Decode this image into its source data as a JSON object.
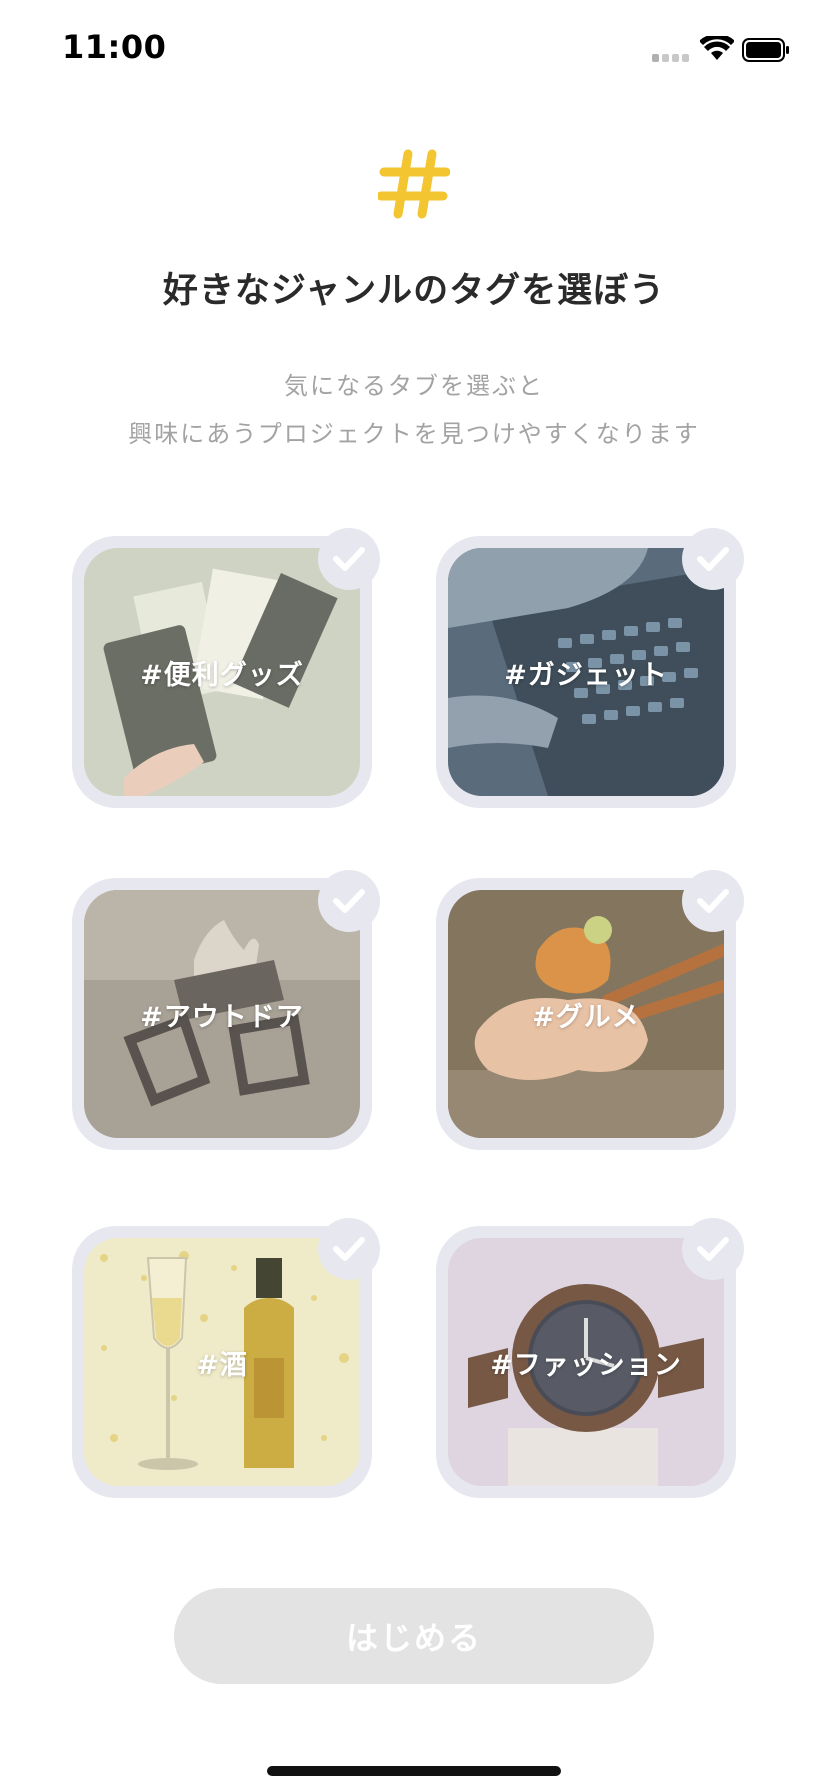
{
  "status_bar": {
    "time": "11:00",
    "icons": [
      "cellular-signal-icon",
      "wifi-icon",
      "battery-icon"
    ]
  },
  "header": {
    "icon": "hash-icon",
    "title": "好きなジャンルのタグを選ぼう",
    "subtitle_line1": "気になるタブを選ぶと",
    "subtitle_line2": "興味にあうプロジェクトを見つけやすくなります"
  },
  "tags": [
    {
      "label": "#便利グッズ",
      "selected": false,
      "icon": "check-icon"
    },
    {
      "label": "#ガジェット",
      "selected": false,
      "icon": "check-icon"
    },
    {
      "label": "#アウトドア",
      "selected": false,
      "icon": "check-icon"
    },
    {
      "label": "#グルメ",
      "selected": false,
      "icon": "check-icon"
    },
    {
      "label": "#酒",
      "selected": false,
      "icon": "check-icon"
    },
    {
      "label": "#ファッション",
      "selected": false,
      "icon": "check-icon"
    }
  ],
  "start_button": {
    "label": "はじめる",
    "enabled": false
  },
  "colors": {
    "accent_yellow": "#f2c531",
    "card_border": "#e6e7ef",
    "button_disabled": "#e3e3e3",
    "subtitle_gray": "#a3a3a3"
  }
}
